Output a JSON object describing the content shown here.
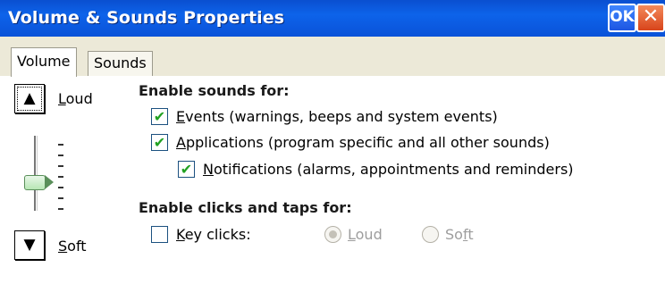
{
  "window": {
    "title": "Volume & Sounds Properties",
    "ok_label": "OK",
    "close_label": "✕"
  },
  "tabs": [
    {
      "label": "Volume",
      "selected": true
    },
    {
      "label": "Sounds",
      "selected": false
    }
  ],
  "volume": {
    "up_icon": "▲",
    "down_icon": "▼",
    "loud_prefix": "",
    "loud_key": "L",
    "loud_rest": "oud",
    "soft_key": "S",
    "soft_rest": "oft",
    "slider_level_fraction": 0.4
  },
  "sounds_section": {
    "heading": "Enable sounds for:",
    "events": {
      "key": "E",
      "rest": "vents (warnings, beeps and system events)",
      "checked": true
    },
    "applications": {
      "key": "A",
      "rest": "pplications (program specific and all other sounds)",
      "checked": true
    },
    "notifications": {
      "key": "N",
      "rest": "otifications (alarms, appointments and reminders)",
      "checked": true
    }
  },
  "clicks_section": {
    "heading": "Enable clicks and taps for:",
    "key_clicks": {
      "key": "K",
      "rest": "ey clicks:",
      "checked": false
    },
    "radio_loud": {
      "key": "L",
      "rest": "oud",
      "selected": true
    },
    "radio_soft": {
      "pre": "So",
      "key": "f",
      "rest": "t",
      "selected": false
    }
  },
  "check_glyph": "✔",
  "colors": {
    "titlebar": "#0d5ce0",
    "check": "#21a121"
  }
}
